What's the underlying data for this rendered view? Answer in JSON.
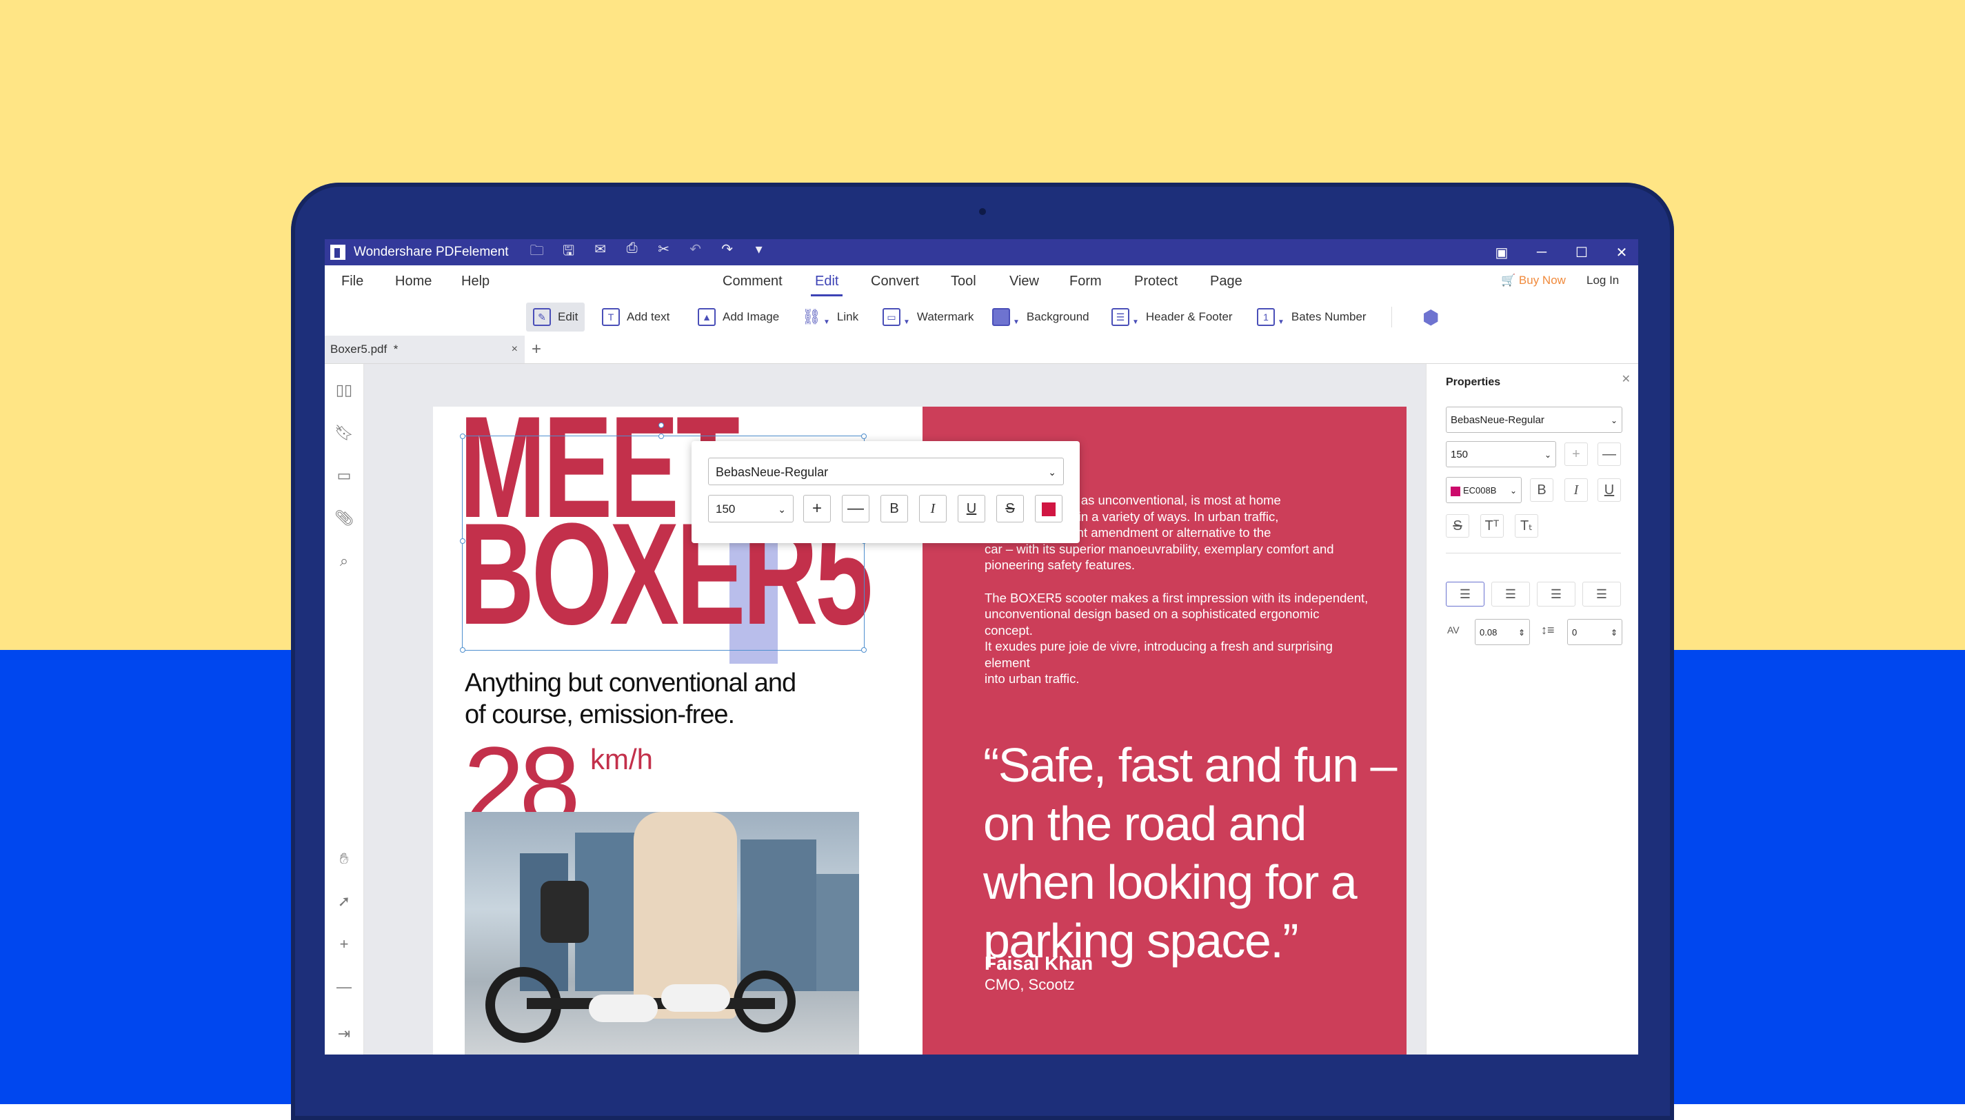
{
  "colors": {
    "accent": "#3d43b5",
    "title_bar": "#33399a",
    "red_panel": "#cc3e59",
    "headline": "#c3304b",
    "buy_now": "#f08a3c",
    "text_color_swatch": "#d01642"
  },
  "window": {
    "title": "Wondershare PDFelement",
    "titlebar_icons": [
      "folder-icon",
      "save-icon",
      "mail-icon",
      "print-icon",
      "scissors-icon",
      "undo-icon",
      "redo-icon",
      "dropdown-arrow-icon"
    ],
    "controls": [
      "notification-icon",
      "minimize-icon",
      "maximize-icon",
      "close-icon"
    ]
  },
  "menu": {
    "left": [
      "File",
      "Home",
      "Help"
    ],
    "center": [
      "Comment",
      "Edit",
      "Convert",
      "Tool",
      "View",
      "Form",
      "Protect",
      "Page"
    ],
    "active": "Edit",
    "buy_now": "Buy Now",
    "log_in": "Log In"
  },
  "ribbon": {
    "edit": "Edit",
    "add_text": "Add text",
    "add_image": "Add Image",
    "link": "Link",
    "watermark": "Watermark",
    "background": "Background",
    "header_footer": "Header & Footer",
    "bates_number": "Bates Number"
  },
  "tabs": {
    "doc_name": "Boxer5.pdf",
    "modified_mark": "*",
    "close": "×",
    "add": "+"
  },
  "sidebar": {
    "icons": [
      "thumbnails-icon",
      "bookmark-icon",
      "comment-icon",
      "attachment-icon",
      "search-icon",
      "hand-icon",
      "select-icon",
      "zoom-in-icon",
      "zoom-out-icon",
      "fit-page-icon"
    ]
  },
  "document": {
    "headline_line1": "MEET",
    "headline_line2a": "BOXER",
    "headline_line2b": "5",
    "subtitle_line1": "Anything but conventional and",
    "subtitle_line2": "of course, emission-free.",
    "speed_value": "28",
    "speed_unit": "km/h",
    "body_p1": "oter, as practical as unconventional, is most at home\ne it can be used in a variety of ways. In urban traffic,\nter is an intelligent amendment or alternative to the\ncar – with its superior manoeuvrability, exemplary comfort and\npioneering safety features.",
    "body_p2": "The BOXER5 scooter makes a first impression with its independent,\nunconventional design based on a sophisticated ergonomic concept.\nIt exudes pure joie de vivre, introducing a fresh and surprising element\ninto urban traffic.",
    "quote": "“Safe, fast and fun – on the road and when looking for a parking space.”",
    "author": "Faisal Khan",
    "author_role": "CMO, Scootz"
  },
  "float_toolbar": {
    "font": "BebasNeue-Regular",
    "size": "150",
    "buttons": [
      "+",
      "—",
      "B",
      "I",
      "U",
      "S"
    ]
  },
  "properties": {
    "title": "Properties",
    "font": "BebasNeue-Regular",
    "size": "150",
    "color_value": "EC008B",
    "char_spacing": "0.08",
    "line_spacing": "0"
  }
}
